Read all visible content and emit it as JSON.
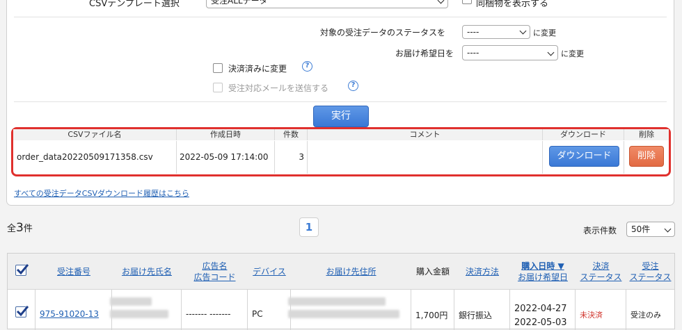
{
  "form": {
    "template_label": "CSVテンプレート選択",
    "template_value": "受注ALLデータ",
    "show_bundle_label": "同梱物を表示する",
    "status_prefix": "対象の受注データのステータスを",
    "status_value": "----",
    "status_suffix": "に変更",
    "delivery_prefix": "お届け希望日を",
    "delivery_value": "----",
    "delivery_suffix": "に変更",
    "paid_label": "決済済みに変更",
    "mail_label": "受注対応メールを送信する",
    "execute_label": "実行"
  },
  "csv_table": {
    "headers": [
      "CSVファイル名",
      "作成日時",
      "件数",
      "コメント",
      "ダウンロード",
      "削除"
    ],
    "row": {
      "filename": "order_data20220509171358.csv",
      "created": "2022-05-09 17:14:00",
      "count": "3",
      "comment": "",
      "download_label": "ダウンロード",
      "delete_label": "削除"
    }
  },
  "history_link": "すべての受注データCSVダウンロード履歴はこちら",
  "summary": {
    "total_prefix": "全",
    "total_count": "3",
    "total_suffix": "件",
    "page": "1",
    "per_page_label": "表示件数",
    "per_page_value": "50件"
  },
  "orders": {
    "headers": {
      "order_no": "受注番号",
      "name": "お届け先氏名",
      "ad_line1": "広告名",
      "ad_line2": "広告コード",
      "device": "デバイス",
      "address": "お届け先住所",
      "amount": "購入金額",
      "payment": "決済方法",
      "date_line1": "購入日時 ▼",
      "date_line2": "お届け希望日",
      "pay_status_line1": "決済",
      "pay_status_line2": "ステータス",
      "order_status_line1": "受注",
      "order_status_line2": "ステータス"
    },
    "row": {
      "order_no": "975-91020-13",
      "ad": "------- -------",
      "device": "PC",
      "amount": "1,700円",
      "payment": "銀行振込",
      "date": "2022-04-27",
      "date2": "2022-05-03",
      "pay_status": "未決済",
      "order_status": "受注のみ"
    }
  },
  "colors": {
    "accent": "#3a78d6",
    "link": "#1f5fb3",
    "highlight": "#e0302d",
    "danger_text": "#d0342c",
    "delete_button": "#e26a43"
  },
  "icons": [
    "chevron-down-icon",
    "help-icon",
    "checkmark-icon"
  ]
}
